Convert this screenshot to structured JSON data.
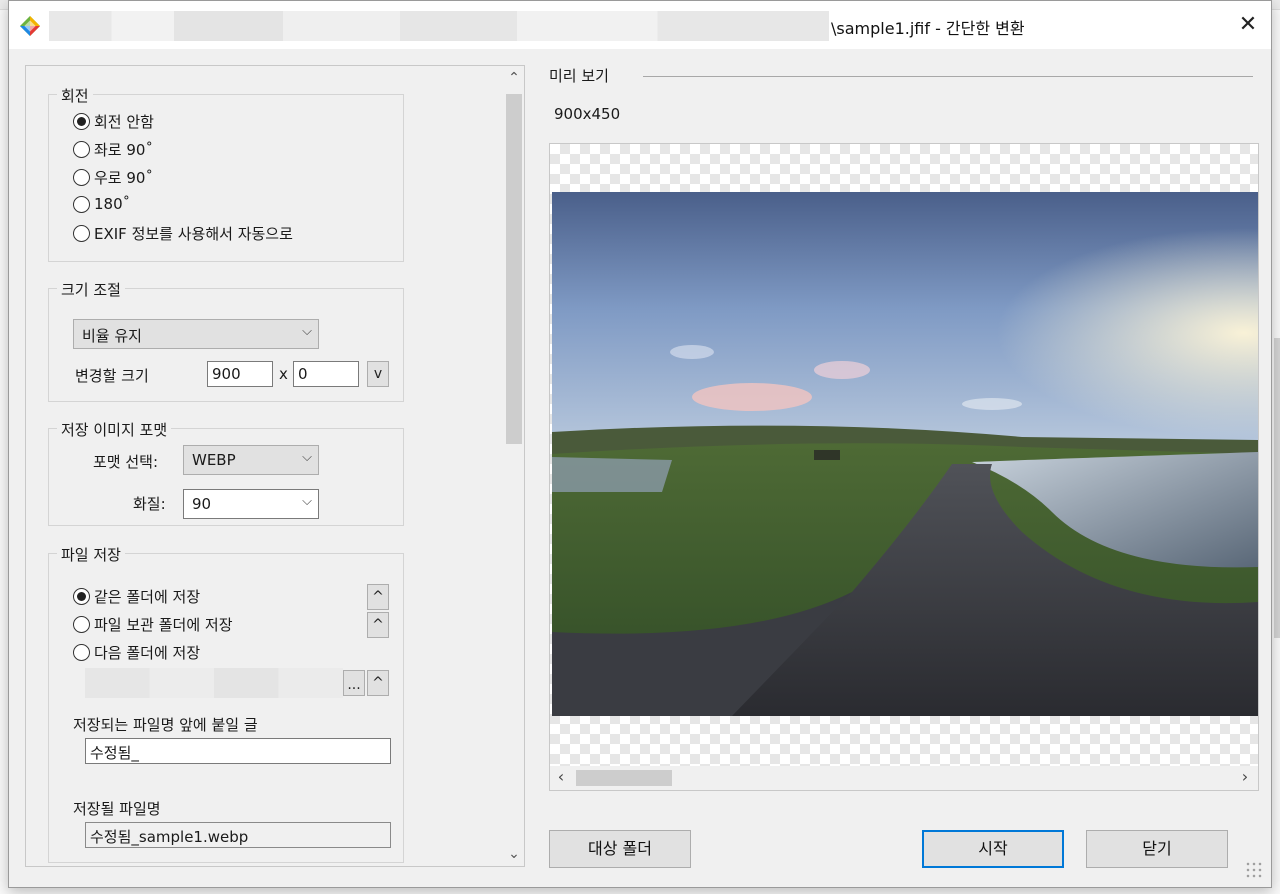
{
  "window": {
    "title_suffix": "\\sample1.jfif - 간단한 변환",
    "close_symbol": "✕",
    "icon": "app-diamond-icon"
  },
  "rotation": {
    "legend": "회전",
    "options": [
      {
        "label": "회전 안함",
        "checked": true
      },
      {
        "label": "좌로 90˚",
        "checked": false
      },
      {
        "label": "우로 90˚",
        "checked": false
      },
      {
        "label": "180˚",
        "checked": false
      },
      {
        "label": "EXIF 정보를 사용해서 자동으로",
        "checked": false
      }
    ]
  },
  "resize": {
    "legend": "크기 조절",
    "mode": "비율 유지",
    "size_label": "변경할 크기",
    "width": "900",
    "x_sep": "x",
    "height": "0",
    "v_button": "v"
  },
  "format": {
    "legend": "저장 이미지 포맷",
    "format_label": "포맷 선택:",
    "format_value": "WEBP",
    "quality_label": "화질:",
    "quality_value": "90"
  },
  "save": {
    "legend": "파일 저장",
    "options": [
      {
        "label": "같은 폴더에 저장",
        "checked": true
      },
      {
        "label": "파일 보관 폴더에 저장",
        "checked": false
      },
      {
        "label": "다음 폴더에 저장",
        "checked": false
      }
    ],
    "up_symbol": "^",
    "browse_label": "...",
    "prefix_label": "저장되는 파일명 앞에 붙일 글",
    "prefix_value": "수정됨_",
    "filename_label": "저장될 파일명",
    "filename_value": "수정됨_sample1.webp"
  },
  "preview": {
    "label": "미리 보기",
    "dimensions": "900x450"
  },
  "scroll": {
    "up": "⌃",
    "down": "⌄",
    "left": "‹",
    "right": "›"
  },
  "buttons": {
    "target_folder": "대상 폴더",
    "start": "시작",
    "close": "닫기"
  },
  "colors": {
    "accent": "#0078d7"
  }
}
